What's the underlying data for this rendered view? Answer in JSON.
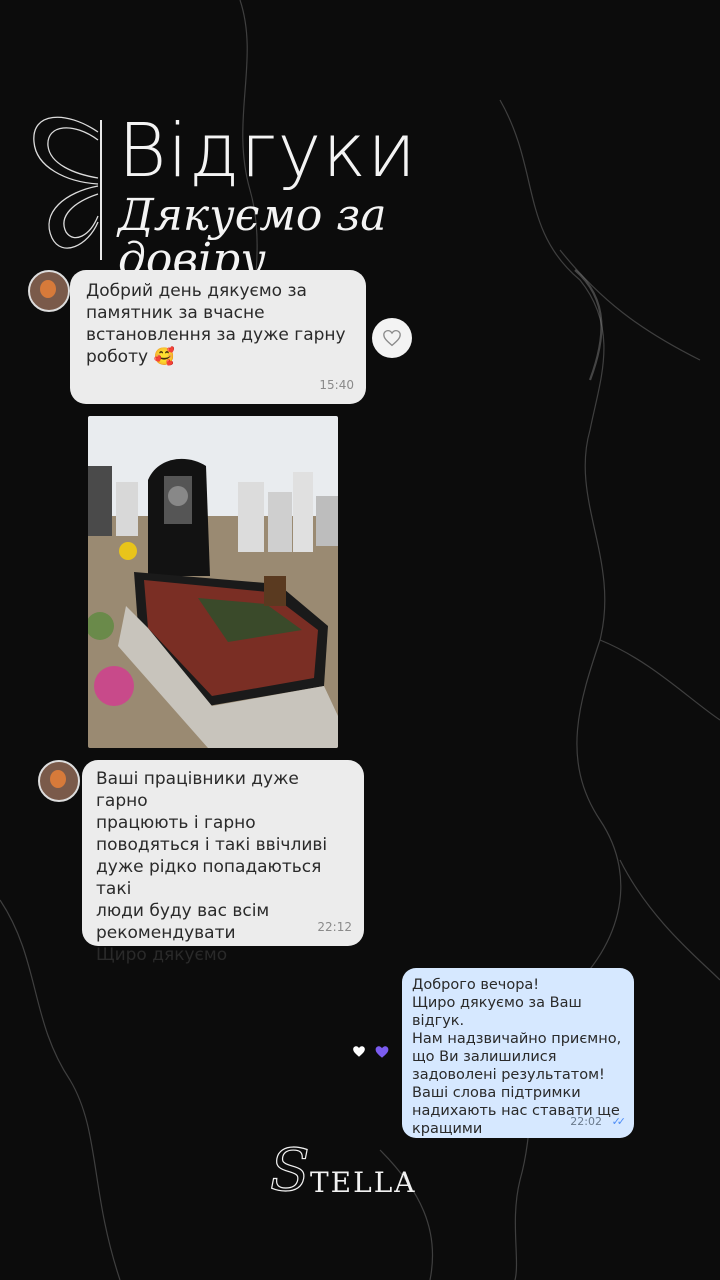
{
  "header": {
    "title": "Відгуки",
    "subtitle": "Дякуємо за довіру"
  },
  "messages": [
    {
      "text": "Добрий день дякуємо за\nпамятник за вчасне\nвстановлення за дуже гарну\nроботу 🥰",
      "time": "15:40"
    },
    {
      "text": "Ваші працівники дуже гарно\nпрацюють і гарно\nповодяться і такі ввічливі\nдуже рідко попадаються такі\nлюди буду вас всім\nрекомендувати\nЩиро дякуємо",
      "time": "22:12"
    }
  ],
  "reply": {
    "text": "Доброго вечора!\nЩиро дякуємо за Ваш відгук.\nНам надзвичайно приємно,\nщо Ви залишилися\nзадоволені результатом!\nВаші слова підтримки\nнадихають нас ставати ще\nкращими",
    "time": "22:02",
    "ticks": "✓✓"
  },
  "reactions": [
    "white-heart-icon",
    "purple-heart-icon"
  ],
  "logo": {
    "text": "TELLA",
    "mark": "S"
  },
  "colors": {
    "background": "#0c0c0c",
    "bubble": "#ececec",
    "reply_bubble": "#d6e8ff",
    "accent_purple": "#7b5cf0",
    "tick_blue": "#4f8ef7"
  }
}
